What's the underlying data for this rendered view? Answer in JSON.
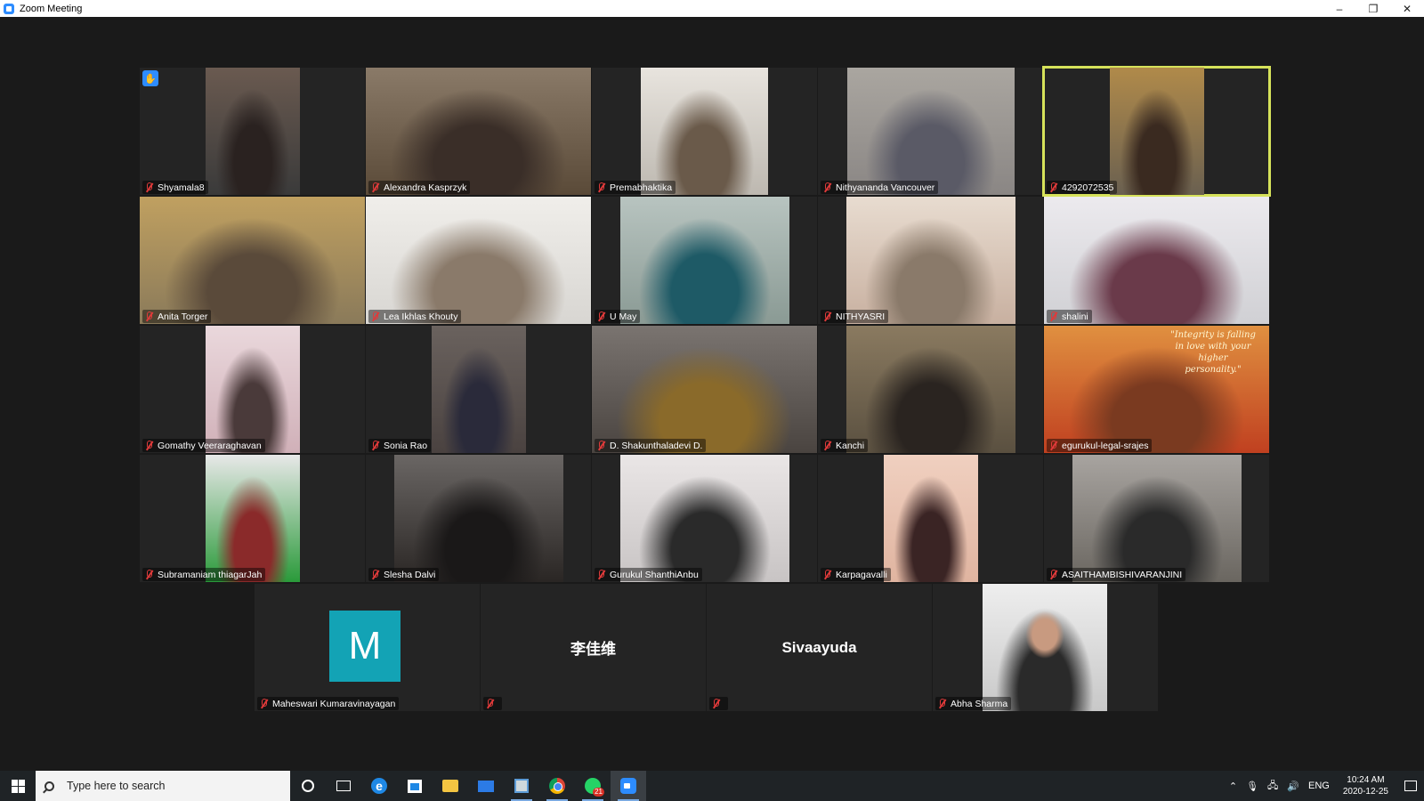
{
  "window": {
    "title": "Zoom Meeting",
    "minimize": "–",
    "restore": "❐",
    "close": "✕"
  },
  "participants": [
    {
      "name": "Shyamala8",
      "raised_hand": true,
      "colors": [
        "#3a3a3a",
        "#6a5a50",
        "#2a2220"
      ]
    },
    {
      "name": "Alexandra Kasprzyk",
      "colors": [
        "#5a4a38",
        "#8a7a68",
        "#3a2e28"
      ]
    },
    {
      "name": "Premabhaktika",
      "colors": [
        "#bdb8b0",
        "#e8e4de",
        "#6a5a4a"
      ]
    },
    {
      "name": "Nithyananda Vancouver",
      "colors": [
        "#8a8684",
        "#aaa6a0",
        "#5a5a66"
      ]
    },
    {
      "name": "4292072535",
      "active_speaker": true,
      "colors": [
        "#6a6050",
        "#b08a4a",
        "#3a2a20"
      ]
    },
    {
      "name": "Anita Torger",
      "colors": [
        "#8a7a5a",
        "#c0a060",
        "#5a4a3a"
      ]
    },
    {
      "name": "Lea Ikhlas Khouty",
      "colors": [
        "#d8d6d2",
        "#f0eeea",
        "#8a7a6a"
      ]
    },
    {
      "name": "U May",
      "colors": [
        "#8a9a94",
        "#b8c4c0",
        "#1e5a66"
      ]
    },
    {
      "name": "NITHYASRI",
      "colors": [
        "#c8b0a0",
        "#e8dcd0",
        "#8a7a6a"
      ]
    },
    {
      "name": "shalini",
      "colors": [
        "#d0d0d4",
        "#eceaee",
        "#6a3a4a"
      ]
    },
    {
      "name": "Gomathy Veeraraghavan",
      "colors": [
        "#d0b0b8",
        "#ead8dc",
        "#4a3a3a"
      ]
    },
    {
      "name": "Sonia Rao",
      "colors": [
        "#4a4240",
        "#6a625e",
        "#2a2a3a"
      ]
    },
    {
      "name": "D. Shakunthaladevi D.",
      "colors": [
        "#4a4440",
        "#7a7470",
        "#8a6a2a"
      ]
    },
    {
      "name": "Kanchi",
      "colors": [
        "#5a5040",
        "#8a7a60",
        "#2a2420"
      ]
    },
    {
      "name": "egurukul-legal-srajes",
      "colors": [
        "#c04020",
        "#e09040",
        "#7a3a20"
      ]
    },
    {
      "name": "Subramaniam thiagarJah",
      "colors": [
        "#2a9a3a",
        "#e8e8e8",
        "#8a2a2a"
      ]
    },
    {
      "name": "Slesha Dalvi",
      "colors": [
        "#2a2624",
        "#6a6664",
        "#1a1818"
      ]
    },
    {
      "name": "Gurukul ShanthiAnbu",
      "colors": [
        "#c8c4c4",
        "#eae6e6",
        "#2a2a2a"
      ]
    },
    {
      "name": "Karpagavalli",
      "colors": [
        "#e0b4a0",
        "#f0d0c0",
        "#3a2424"
      ]
    },
    {
      "name": "ASAITHAMBISHIVARANJINI",
      "colors": [
        "#6a6660",
        "#a8a4a0",
        "#2a2a2a"
      ]
    }
  ],
  "bottom_row": [
    {
      "name": "Maheswari Kumaravinayagan",
      "avatar_letter": "M"
    },
    {
      "name": "",
      "display_name": "李佳维"
    },
    {
      "name": "",
      "display_name": "Sivaayuda"
    },
    {
      "name": "Abha Sharma",
      "colors": [
        "#c8c8c8",
        "#eeeeee",
        "#2a2a2a"
      ]
    }
  ],
  "overlay_text": {
    "quote_line1": "\"Integrity is falling",
    "quote_line2": "in love with your",
    "quote_line3": "higher",
    "quote_line4": "personality.\""
  },
  "taskbar": {
    "search_placeholder": "Type here to search",
    "whatsapp_badge": "21",
    "lang": "ENG",
    "time": "10:24 AM",
    "date": "2020-12-25"
  },
  "accent": {
    "active_speaker_border": "#d6e25a",
    "zoom_blue": "#2d8cff",
    "muted_red": "#e03a3a"
  }
}
